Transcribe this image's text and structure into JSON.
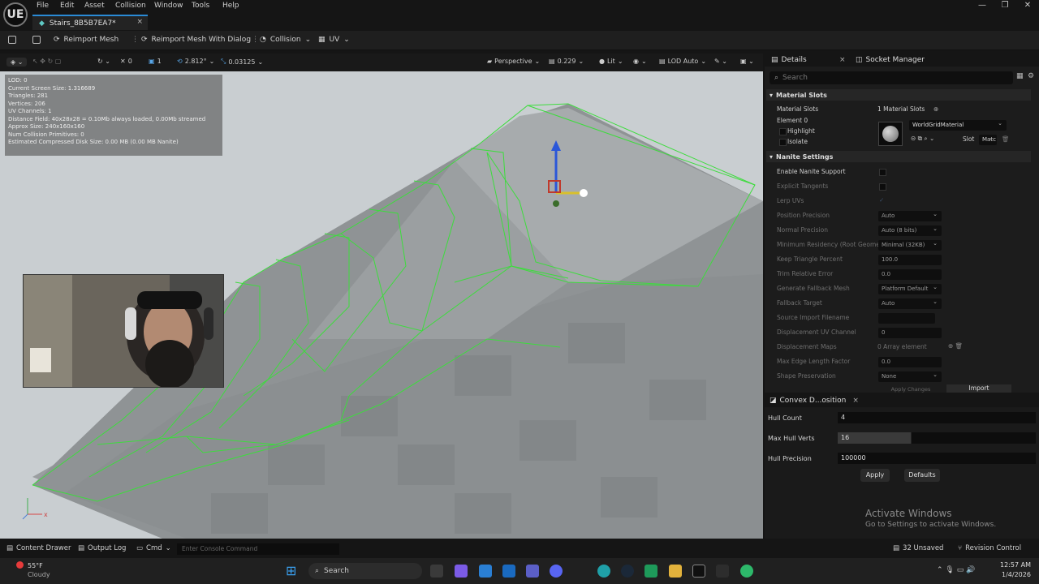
{
  "app": {
    "logo": "UE",
    "menu": [
      "File",
      "Edit",
      "Asset",
      "Collision",
      "Window",
      "Tools",
      "Help"
    ],
    "window_buttons": [
      "—",
      "❐",
      "✕"
    ]
  },
  "tab": {
    "title": "Stairs_8B5B7EA7*",
    "close": "×"
  },
  "toolbar": {
    "reimport": "Reimport Mesh",
    "reimport_dialog": "Reimport Mesh With Dialog",
    "collision": "Collision",
    "uv": "UV"
  },
  "viewport_toolbar": {
    "n1": "0",
    "n2": "1",
    "snap": "2.812°",
    "scale_snap": "0.03125",
    "view_mode": "Perspective",
    "fov": "0.229",
    "lighting": "Lit",
    "lod": "LOD Auto"
  },
  "stats": [
    "LOD: 0",
    "Current Screen Size: 1.316689",
    "Triangles: 281",
    "Vertices: 206",
    "UV Channels: 1",
    "Distance Field: 40x28x28 = 0.10Mb always loaded, 0.00Mb streamed",
    "Approx Size: 240x160x160",
    "Num Collision Primitives: 0",
    "Estimated Compressed Disk Size: 0.00 MB (0.00 MB Nanite)"
  ],
  "details": {
    "tab_details": "Details",
    "tab_socket": "Socket Manager",
    "search_placeholder": "Search",
    "material_slots_header": "Material Slots",
    "material_slots_label": "Material Slots",
    "material_slots_value": "1 Material Slots",
    "element0": "Element 0",
    "highlight": "Highlight",
    "isolate": "Isolate",
    "material_name": "WorldGridMaterial",
    "slot_label": "Slot",
    "matc_label": "Matc",
    "nanite_header": "Nanite Settings",
    "props": [
      {
        "label": "Enable Nanite Support",
        "value": ""
      },
      {
        "label": "Explicit Tangents",
        "value": ""
      },
      {
        "label": "Lerp UVs",
        "value": ""
      },
      {
        "label": "Position Precision",
        "value": "Auto"
      },
      {
        "label": "Normal Precision",
        "value": "Auto (8 bits)"
      },
      {
        "label": "Minimum Residency (Root Geome",
        "value": "Minimal (32KB)"
      },
      {
        "label": "Keep Triangle Percent",
        "value": "100.0"
      },
      {
        "label": "Trim Relative Error",
        "value": "0.0"
      },
      {
        "label": "Generate Fallback Mesh",
        "value": "Platform Default"
      },
      {
        "label": "Fallback Target",
        "value": "Auto"
      },
      {
        "label": "Source Import Filename",
        "value": ""
      },
      {
        "label": "Displacement UV Channel",
        "value": "0"
      },
      {
        "label": "Displacement Maps",
        "value": "0 Array element"
      },
      {
        "label": "Max Edge Length Factor",
        "value": "0.0"
      },
      {
        "label": "Shape Preservation",
        "value": "None"
      }
    ],
    "apply_changes": "Apply Changes",
    "import": "Import"
  },
  "convex": {
    "tab": "Convex D...osition",
    "hull_count_label": "Hull Count",
    "hull_count": "4",
    "max_verts_label": "Max Hull Verts",
    "max_verts": "16",
    "precision_label": "Hull Precision",
    "precision": "100000",
    "apply": "Apply",
    "defaults": "Defaults",
    "activate_title": "Activate Windows",
    "activate_sub": "Go to Settings to activate Windows."
  },
  "bottom": {
    "content_drawer": "Content Drawer",
    "output_log": "Output Log",
    "cmd": "Cmd",
    "console_placeholder": "Enter Console Command",
    "unsaved": "32 Unsaved",
    "revision": "Revision Control"
  },
  "taskbar": {
    "temp": "55°F",
    "weather": "Cloudy",
    "search": "Search",
    "time": "12:57 AM",
    "date": "1/4/2026"
  },
  "axis": {
    "x": "x",
    "z": "z"
  }
}
